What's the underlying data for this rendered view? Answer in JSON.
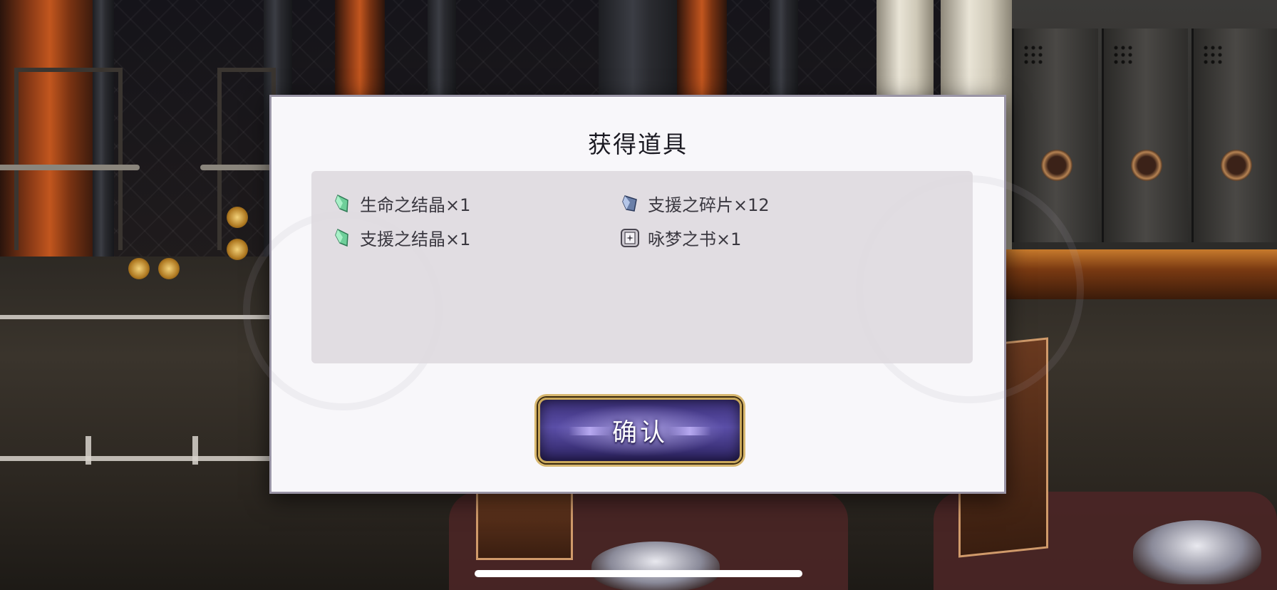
{
  "dialog": {
    "title": "获得道具",
    "items": [
      {
        "icon": "green-crystal-icon",
        "label": "生命之结晶×1"
      },
      {
        "icon": "blue-shard-icon",
        "label": "支援之碎片×12"
      },
      {
        "icon": "green-crystal-icon",
        "label": "支援之结晶×1"
      },
      {
        "icon": "dream-book-icon",
        "label": "咏梦之书×1"
      }
    ],
    "confirm_label": "确认"
  },
  "colors": {
    "dialog_bg": "#f8f7fa",
    "panel_bg": "#dedae0",
    "button_purple": "#3b2f78",
    "button_gold": "#caa85a"
  }
}
